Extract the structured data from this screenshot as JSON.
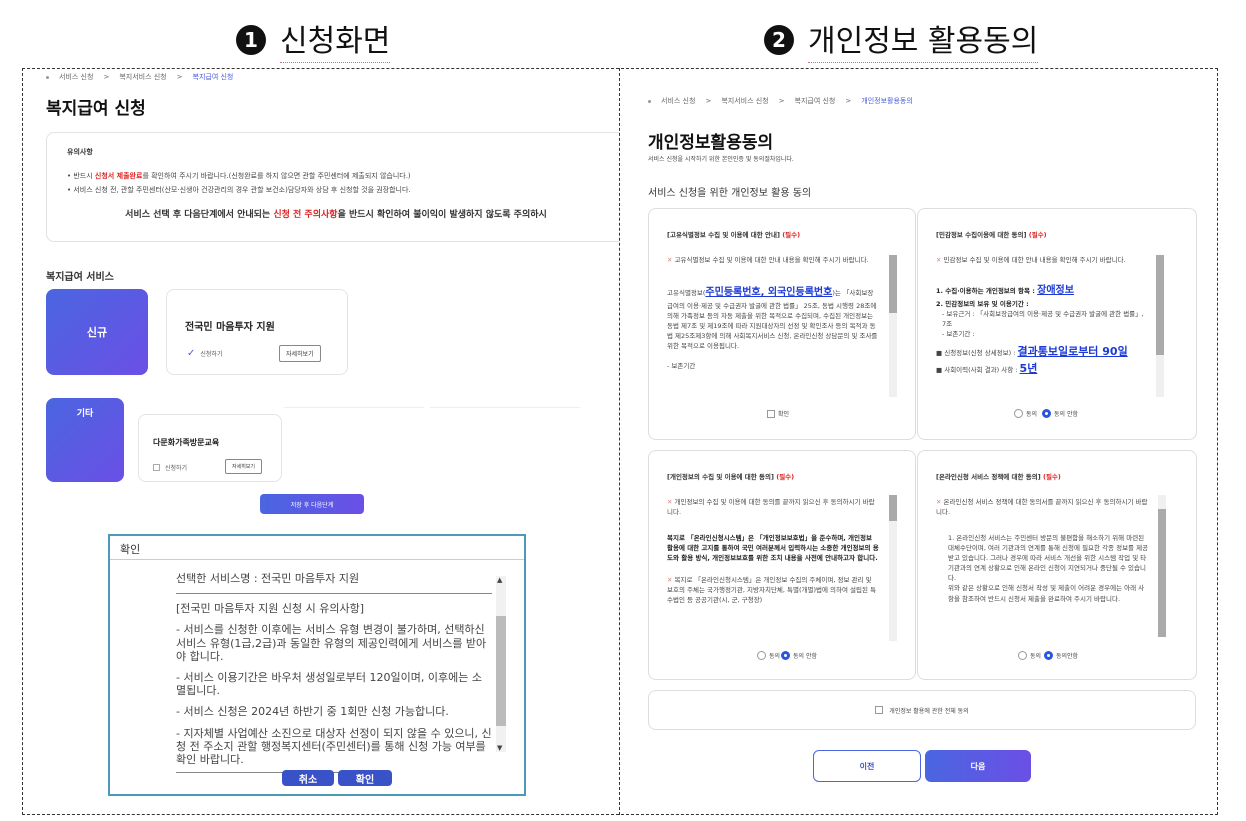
{
  "headings": {
    "left": {
      "num": "1",
      "text": "신청화면"
    },
    "right": {
      "num": "2",
      "text": "개인정보 활용동의"
    }
  },
  "left_panel": {
    "breadcrumb": [
      "서비스 신청",
      "복지서비스 신청",
      "복지급여 신청"
    ],
    "title": "복지급여 신청",
    "notice": {
      "head": "유의사항",
      "line1_pre": "• 반드시 ",
      "line1_red": "신청서 제출완료",
      "line1_post": "를 확인하여 주시기 바랍니다.(신청완료를 하지 않으면 관할 주민센터에 제출되지 않습니다.)",
      "line2": "• 서비스 신청 전, 관할 주민센터(산모·신생아 건강관리의 경우 관할 보건소)담당자와 상담 후 신청할 것을 권장합니다.",
      "big_pre": "서비스 선택 후 다음단계에서 안내되는 ",
      "big_red": "신청 전 주의사항",
      "big_post": "을 반드시 확인하여 불이익이 발생하지 않도록 주의하시"
    },
    "service_label": "복지급여 서비스",
    "tile_new": "신규",
    "tile_other": "기타",
    "card1": {
      "title": "전국민 마음투자 지원",
      "check": "신청하기",
      "detail": "자세히보기"
    },
    "card2": {
      "title": "다문화가족방문교육",
      "check": "신청하기",
      "detail": "자세히보기"
    },
    "next_button": "저장 후 다음단계",
    "dialog": {
      "header": "확인",
      "service_name": "선택한 서비스명 : 전국민 마음투자 지원",
      "caution_title": "[전국민 마음투자 지원 신청 시 유의사항]",
      "item1": "- 서비스를 신청한 이후에는 서비스 유형 변경이 불가하며, 선택하신 서비스 유형(1급,2급)과 동일한 유형의 제공인력에게 서비스를 받아야 합니다.",
      "item2": "- 서비스 이용기간은 바우처 생성일로부터 120일이며, 이후에는 소멸됩니다.",
      "item3": "- 서비스 신청은 2024년 하반기 중 1회만 신청 가능합니다.",
      "item4": "- 지자체별 사업예산 소진으로 대상자 선정이 되지 않을 수 있으니, 신청 전 주소지 관할 행정복지센터(주민센터)를 통해 신청 가능 여부를 확인 바랍니다.",
      "cancel": "취소",
      "confirm": "확인"
    }
  },
  "right_panel": {
    "breadcrumb": [
      "서비스 신청",
      "복지서비스 신청",
      "복지급여 신청",
      "개인정보활용동의"
    ],
    "title": "개인정보활용동의",
    "subtitle": "서비스 신청을 시작하기 위한 본인인증 및 동의절차입니다.",
    "section": "서비스 신청을 위한 개인정보 활용 동의",
    "box1": {
      "header": "[고유식별정보 수집 및 이용에 대한 안내]",
      "req": "(필수)",
      "intro": "고유식별정보 수집 및 이용에 대한 안내 내용을 확인해 주시기 바랍니다.",
      "body_pre": "고유식별정보(",
      "body_link": "주민등록번호, 외국인등록번호",
      "body_post": ")는 「사회보장급여의 이용·제공 및 수급권자 발굴에 관한 법률」 25조, 동법 시행령 28조에 의해 가족정보 등의 자동 제출을 위한 목적으로 수집되며, 수집된 개인정보는 동법 제7조 및 제19조에 따라 지원대상자의 선정 및 확인조사 등의 목적과 동법 제25조제3항에 의해 사회복지서비스 신청, 온라인신청 상담문의 및 조사를 위한 목적으로 이용됩니다.",
      "keep": "- 보존기간",
      "check": "확인"
    },
    "box2": {
      "header": "[민감정보 수집이용에 대한 동의]",
      "req": "(필수)",
      "intro": "민감정보 수집 및 이용에 대한 안내 내용을 확인해 주시기 바랍니다.",
      "item1_pre": "1. 수집·이용하는 개인정보의 항목 : ",
      "item1_link": "장애정보",
      "item2": "2. 민감정보의 보유 및 이용기간 :",
      "basis": "- 보유근거 : 「사회보장급여의 이용·제공 및 수급권자 발굴에 관한 법률」, 7조",
      "period": "- 보존기간 :",
      "bullet_pre": "■ 신청정보(신청 상세정보) : ",
      "bullet_link": "결과통보일로부터 90일",
      "cut_pre": "■ 사회이력(사회 결과) 사항 : ",
      "cut_link": "5년",
      "agree": "동의",
      "disagree": "동의 안함"
    },
    "box3": {
      "header": "[개인정보의 수집 및 이용에 대한 동의]",
      "req": "(필수)",
      "intro": "개인정보의 수집 및 이용에 대한 동의를 끝까지 읽으신 후 동의하시기 바랍니다.",
      "body": "복지로 「온라인신청시스템」은 「개인정보보호법」을 준수하며, 개인정보 활용에 대한 고지를 통하여 국민 여러분께서 입력하시는 소중한 개인정보의 용도와 활용 방식, 개인정보보호를 위한 조치 내용을 사전에 안내하고자 합니다.",
      "body2": "복지로 「온라인신청시스템」은 개인정보 수집의 주체이며, 정보 관리 및 보호의 주체는 국가행정기관, 지방자치단체, 특별(개별)법에 의하여 설립된 특수법인 등 공공기관(시, 군, 구청장)",
      "agree": "동의",
      "disagree": "동의 안함"
    },
    "box4": {
      "header": "[온라인신청 서비스 정책에 대한 동의]",
      "req": "(필수)",
      "intro": "온라인신청 서비스 정책에 대한 동의서를 끝까지 읽으신 후 동의하시기 바랍니다.",
      "body": "1. 온라인신청 서비스는 주민센터 방문의 불편함을 해소하기 위해 마련된 대체수단이며, 여러 기관과의 연계를 통해 신청에 필요한 각종 정보를 제공받고 있습니다. 그러나 경우에 따라 서비스 개선을 위한 시스템 작업 및 타 기관과의 연계 상황으로 인해 온라인 신청이 지연되거나 중단될 수 있습니다.",
      "body2": "위와 같은 상황으로 인해 신청서 작성 및 제출이 어려운 경우에는 아래 사항을 참조하여 반드시 신청서 제출을 완료하여 주시기 바랍니다.",
      "agree": "동의",
      "disagree": "동의안함"
    },
    "all_agree": "개인정보 활용에 관한 전체 동의",
    "prev": "이전",
    "next": "다음"
  }
}
